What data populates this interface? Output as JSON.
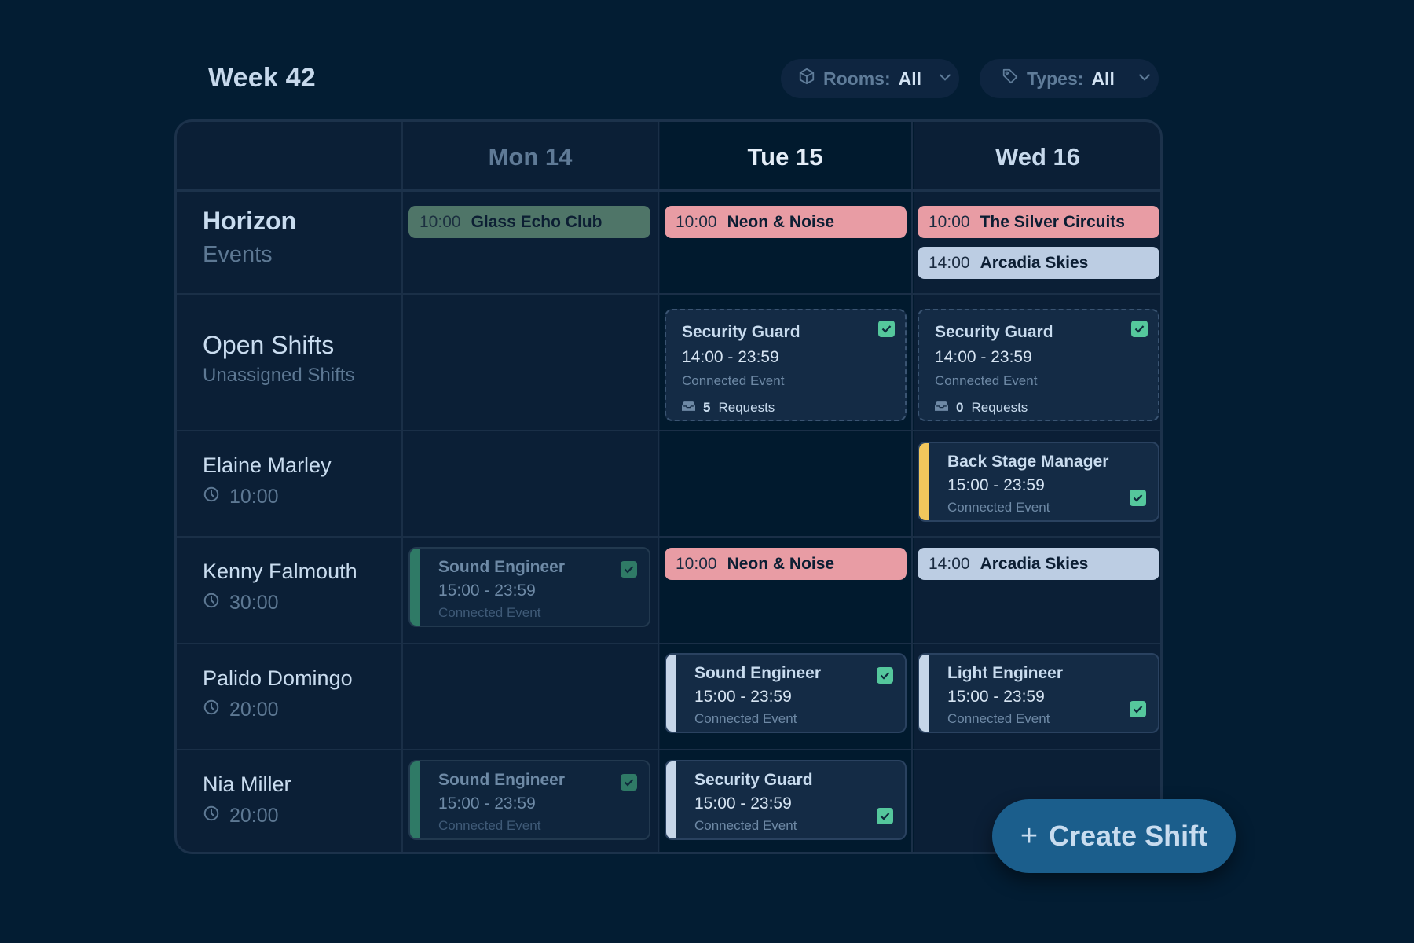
{
  "header": {
    "title": "Week 42",
    "filters": [
      {
        "label": "Rooms:",
        "value": "All",
        "icon": "cube-icon"
      },
      {
        "label": "Types:",
        "value": "All",
        "icon": "tag-icon"
      }
    ]
  },
  "days": [
    {
      "label": "Mon 14",
      "state": "past"
    },
    {
      "label": "Tue 15",
      "state": "today"
    },
    {
      "label": "Wed 16",
      "state": "upcoming"
    }
  ],
  "rows": {
    "horizon": {
      "title": "Horizon",
      "subtitle": "Events"
    },
    "open": {
      "title": "Open Shifts",
      "subtitle": "Unassigned Shifts"
    },
    "people": [
      {
        "name": "Elaine Marley",
        "hours": "10:00"
      },
      {
        "name": "Kenny Falmouth",
        "hours": "30:00"
      },
      {
        "name": "Palido Domingo",
        "hours": "20:00"
      },
      {
        "name": "Nia Miller",
        "hours": "20:00"
      }
    ]
  },
  "events": {
    "mon": [
      {
        "time": "10:00",
        "name": "Glass Echo Club",
        "color": "#4f7568"
      }
    ],
    "tue": [
      {
        "time": "10:00",
        "name": "Neon & Noise",
        "color": "#e89ca4"
      }
    ],
    "wed": [
      {
        "time": "10:00",
        "name": "The Silver Circuits",
        "color": "#e89ca4"
      },
      {
        "time": "14:00",
        "name": "Arcadia Skies",
        "color": "#bccde3"
      }
    ]
  },
  "open_shifts": {
    "tue": {
      "role": "Security Guard",
      "hours": "14:00 - 23:59",
      "connected": "Connected Event",
      "requests_count": "5",
      "requests_label": "Requests",
      "checked": true
    },
    "wed": {
      "role": "Security Guard",
      "hours": "14:00 - 23:59",
      "connected": "Connected Event",
      "requests_count": "0",
      "requests_label": "Requests",
      "checked": true
    }
  },
  "assigned": {
    "elaine_wed": {
      "role": "Back Stage Manager",
      "hours": "15:00 - 23:59",
      "connected": "Connected Event",
      "stripe": "#f2c75c",
      "checked": true
    },
    "kenny_mon": {
      "role": "Sound Engineer",
      "hours": "15:00 - 23:59",
      "connected": "Connected Event",
      "stripe": "#2f7a66",
      "checked": true
    },
    "kenny_tue": {
      "time": "10:00",
      "name": "Neon & Noise",
      "color": "#e89ca4"
    },
    "kenny_wed": {
      "time": "14:00",
      "name": "Arcadia Skies",
      "color": "#bccde3"
    },
    "palido_tue": {
      "role": "Sound Engineer",
      "hours": "15:00 - 23:59",
      "connected": "Connected Event",
      "stripe": "#c6d6e8",
      "checked": true
    },
    "palido_wed": {
      "role": "Light Engineer",
      "hours": "15:00 - 23:59",
      "connected": "Connected Event",
      "stripe": "#c6d6e8",
      "checked": true
    },
    "nia_mon": {
      "role": "Sound Engineer",
      "hours": "15:00 - 23:59",
      "connected": "Connected Event",
      "stripe": "#2f7a66",
      "checked": true
    },
    "nia_tue": {
      "role": "Security Guard",
      "hours": "15:00 - 23:59",
      "connected": "Connected Event",
      "stripe": "#c6d6e8",
      "checked": true
    }
  },
  "actions": {
    "create_shift": "Create Shift",
    "create_icon": "+"
  },
  "colors": {
    "accent": "#1b5e8c",
    "check": "#55c79c",
    "background": "#031d33"
  }
}
